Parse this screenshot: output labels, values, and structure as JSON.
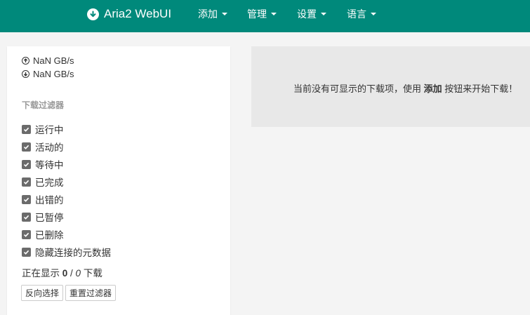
{
  "app": {
    "title": "Aria2 WebUI"
  },
  "nav": {
    "items": [
      {
        "label": "添加"
      },
      {
        "label": "管理"
      },
      {
        "label": "设置"
      },
      {
        "label": "语言"
      }
    ]
  },
  "stats": {
    "upload_speed": "NaN GB/s",
    "download_speed": "NaN GB/s"
  },
  "filters": {
    "heading": "下载过滤器",
    "items": [
      {
        "label": "运行中",
        "checked": true
      },
      {
        "label": "活动的",
        "checked": true
      },
      {
        "label": "等待中",
        "checked": true
      },
      {
        "label": "已完成",
        "checked": true
      },
      {
        "label": "出错的",
        "checked": true
      },
      {
        "label": "已暂停",
        "checked": true
      },
      {
        "label": "已删除",
        "checked": true
      },
      {
        "label": "隐藏连接的元数据",
        "checked": true
      }
    ],
    "showing_prefix": "正在显示",
    "showing_count": "0",
    "showing_separator": " / ",
    "showing_total": "0",
    "showing_suffix": "下载",
    "invert_button": "反向选择",
    "reset_button": "重置过滤器"
  },
  "main": {
    "empty_prefix": "当前没有可显示的下载项，使用",
    "empty_action": "添加",
    "empty_suffix": "按钮来开始下载！"
  },
  "colors": {
    "navbar": "#00897b",
    "background": "#f4f4f4",
    "checkbox": "#6b6b6b"
  }
}
